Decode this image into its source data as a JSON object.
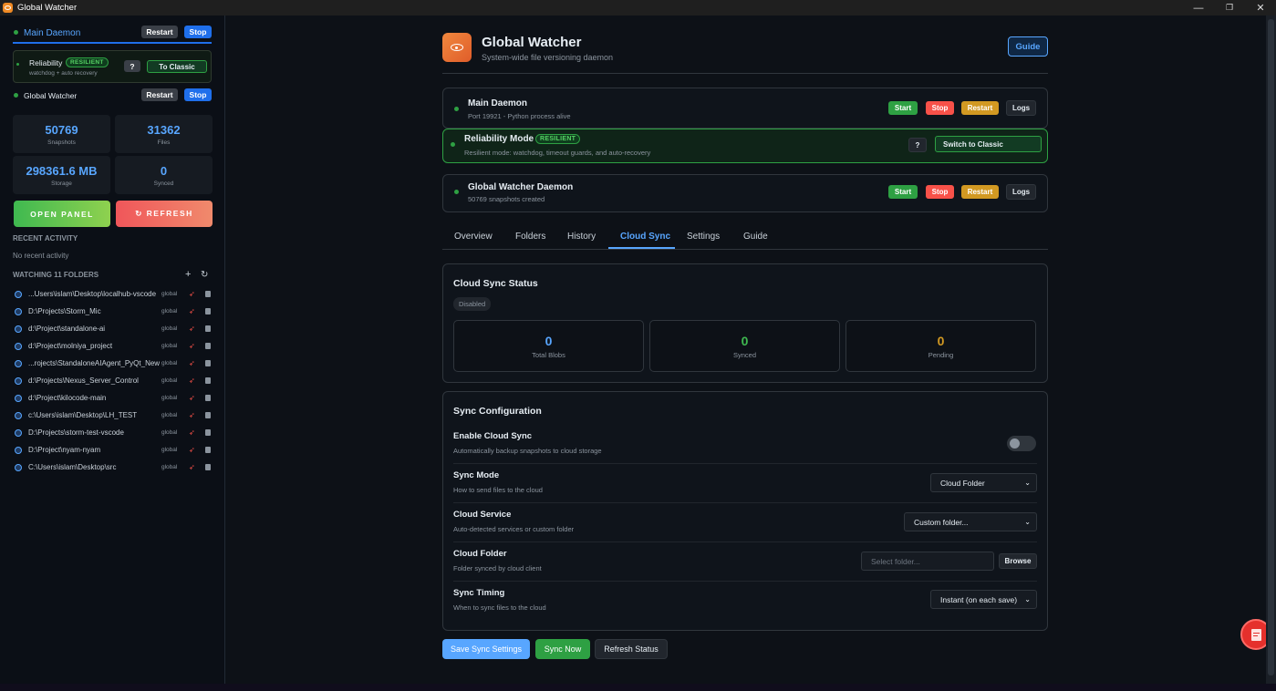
{
  "window": {
    "title": "Global Watcher",
    "controls": [
      "—",
      "❐",
      "✕"
    ]
  },
  "sidebar": {
    "main_daemon": {
      "label": "Main Daemon",
      "restart": "Restart",
      "stop": "Stop"
    },
    "reliability": {
      "label": "Reliability",
      "badge": "RESILIENT",
      "sub": "watchdog + auto recovery",
      "help": "?",
      "switch": "To Classic"
    },
    "global_watcher": {
      "label": "Global Watcher",
      "restart": "Restart",
      "stop": "Stop"
    },
    "stats": [
      {
        "value": "50769",
        "label": "Snapshots"
      },
      {
        "value": "31362",
        "label": "Files"
      },
      {
        "value": "298361.6 MB",
        "label": "Storage"
      },
      {
        "value": "0",
        "label": "Synced"
      }
    ],
    "open_panel": "OPEN PANEL",
    "refresh": "↻ REFRESH",
    "recent_activity_title": "RECENT ACTIVITY",
    "recent_activity_empty": "No recent activity",
    "watching_title": "WATCHING 11 FOLDERS",
    "folder_tag": "global",
    "folders": [
      "...Users\\islam\\Desktop\\localhub-vscode",
      "D:\\Projects\\Storm_Mic",
      "d:\\Project\\standalone-ai",
      "d:\\Project\\molniya_project",
      "...rojects\\StandaloneAIAgent_PyQt_New",
      "d:\\Projects\\Nexus_Server_Control",
      "d:\\Project\\kilocode-main",
      "c:\\Users\\islam\\Desktop\\LH_TEST",
      "D:\\Projects\\storm-test-vscode",
      "D:\\Project\\nyam-nyam",
      "C:\\Users\\islam\\Desktop\\src"
    ]
  },
  "header": {
    "title": "Global Watcher",
    "subtitle": "System-wide file versioning daemon",
    "guide": "Guide"
  },
  "daemons": {
    "main": {
      "title": "Main Daemon",
      "sub": "Port 19921 - Python process alive"
    },
    "reliability": {
      "title": "Reliability Mode",
      "badge": "RESILIENT",
      "sub": "Resilient mode: watchdog, timeout guards, and auto-recovery",
      "help": "?",
      "switch": "Switch to Classic"
    },
    "global": {
      "title": "Global Watcher Daemon",
      "sub": "50769 snapshots created"
    },
    "buttons": {
      "start": "Start",
      "stop": "Stop",
      "restart": "Restart",
      "logs": "Logs"
    }
  },
  "tabs": [
    "Overview",
    "Folders",
    "History",
    "Cloud Sync",
    "Settings",
    "Guide"
  ],
  "active_tab": "Cloud Sync",
  "cloud_status": {
    "title": "Cloud Sync Status",
    "state": "Disabled",
    "stats": [
      {
        "value": "0",
        "label": "Total Blobs",
        "color": "#58a6ff"
      },
      {
        "value": "0",
        "label": "Synced",
        "color": "#3fb950"
      },
      {
        "value": "0",
        "label": "Pending",
        "color": "#d29922"
      }
    ]
  },
  "sync_config": {
    "title": "Sync Configuration",
    "enable": {
      "title": "Enable Cloud Sync",
      "sub": "Automatically backup snapshots to cloud storage",
      "enabled": false
    },
    "mode": {
      "title": "Sync Mode",
      "sub": "How to send files to the cloud",
      "value": "Cloud Folder"
    },
    "service": {
      "title": "Cloud Service",
      "sub": "Auto-detected services or custom folder",
      "value": "Custom folder..."
    },
    "folder": {
      "title": "Cloud Folder",
      "sub": "Folder synced by cloud client",
      "placeholder": "Select folder...",
      "browse": "Browse"
    },
    "timing": {
      "title": "Sync Timing",
      "sub": "When to sync files to the cloud",
      "value": "Instant (on each save)"
    }
  },
  "actions": {
    "save": "Save Sync Settings",
    "sync_now": "Sync Now",
    "refresh": "Refresh Status"
  },
  "colors": {
    "accent": "#58a6ff",
    "green": "#2ea043",
    "red": "#f85149",
    "orange": "#d29922",
    "float_button": "#e5302c"
  }
}
